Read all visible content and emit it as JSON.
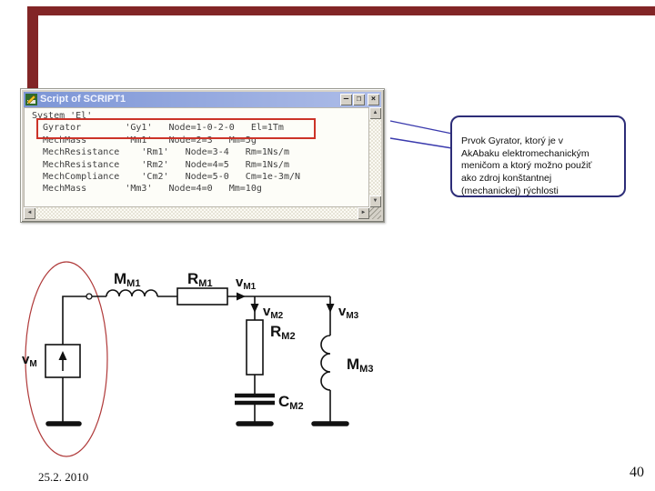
{
  "slide": {
    "footer": {
      "date": "25.2. 2010",
      "page_number": "40"
    }
  },
  "script_window": {
    "title": "Script of SCRIPT1",
    "controls": {
      "minimize": "–",
      "maximize": "❐",
      "close": "×"
    },
    "scrollbar_icons": {
      "up": "▲",
      "down": "▼",
      "left": "◄",
      "right": "►"
    },
    "script_lines": [
      "System 'El'",
      "  Gyrator        'Gy1'   Node=1-0-2-0   El=1Tm",
      "  MechMass       'Mm1'   Node=2=3   Mm=5g",
      "  MechResistance    'Rm1'   Node=3-4   Rm=1Ns/m",
      "  MechResistance    'Rm2'   Node=4=5   Rm=1Ns/m",
      "  MechCompliance    'Cm2'   Node=5-0   Cm=1e-3m/N",
      "  MechMass       'Mm3'   Node=4=0   Mm=10g"
    ]
  },
  "callout": {
    "text": "Prvok Gyrator, ktorý je v\nAkAbaku elektromechanickým\nmeničom a ktorý možno použiť\nako zdroj konštantnej\n(mechanickej) rýchlosti"
  },
  "circuit": {
    "labels": {
      "vm": {
        "main": "v",
        "sub": "M"
      },
      "mm1": {
        "main": "M",
        "sub": "M1"
      },
      "rm1": {
        "main": "R",
        "sub": "M1"
      },
      "vm1": {
        "main": "v",
        "sub": "M1"
      },
      "vm2": {
        "main": "v",
        "sub": "M2"
      },
      "rm2": {
        "main": "R",
        "sub": "M2"
      },
      "vm3": {
        "main": "v",
        "sub": "M3"
      },
      "mm3": {
        "main": "M",
        "sub": "M3"
      },
      "cm2": {
        "main": "C",
        "sub": "M2"
      }
    }
  },
  "colors": {
    "accent_bar": "#822526",
    "highlight_box": "#cc3328",
    "callout_border": "#2d2d78",
    "ellipse": "#b03a3a",
    "titlebar_start": "#7c95d6",
    "titlebar_end": "#aebde8"
  }
}
